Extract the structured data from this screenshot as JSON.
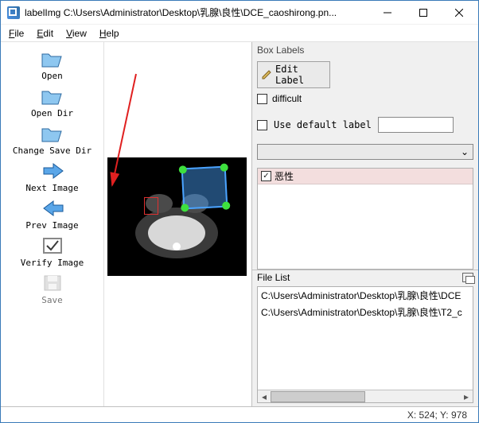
{
  "window": {
    "title": "labelImg C:\\Users\\Administrator\\Desktop\\乳腺\\良性\\DCE_caoshirong.pn..."
  },
  "menu": {
    "file": "File",
    "edit": "Edit",
    "view": "View",
    "help": "Help"
  },
  "tools": {
    "open": "Open",
    "open_dir": "Open Dir",
    "change_save_dir": "Change Save Dir",
    "next_image": "Next Image",
    "prev_image": "Prev Image",
    "verify_image": "Verify Image",
    "save": "Save"
  },
  "box_labels": {
    "title": "Box Labels",
    "edit_label": "Edit Label",
    "difficult": "difficult",
    "use_default_label": "Use default label",
    "entries": [
      {
        "text": "恶性",
        "checked": true
      }
    ]
  },
  "file_list": {
    "title": "File List",
    "items": [
      "C:\\Users\\Administrator\\Desktop\\乳腺\\良性\\DCE",
      "C:\\Users\\Administrator\\Desktop\\乳腺\\良性\\T2_c"
    ]
  },
  "status": {
    "coords": "X: 524; Y: 978"
  }
}
